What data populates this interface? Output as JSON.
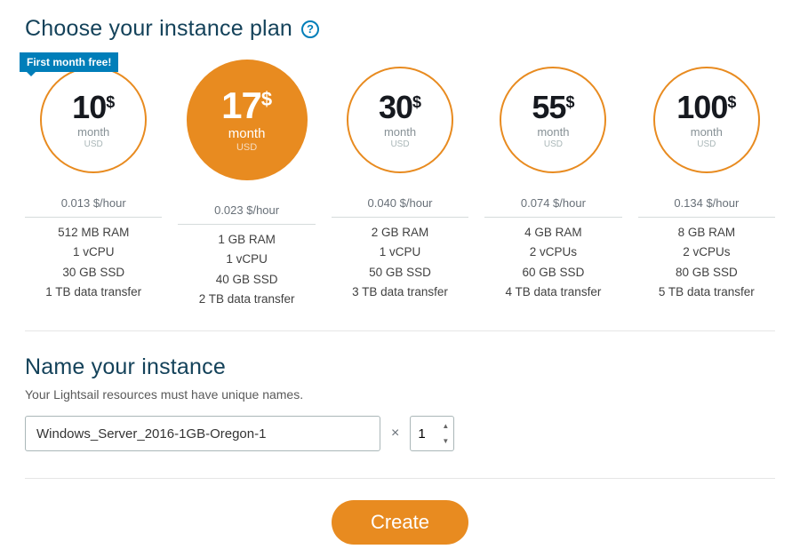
{
  "choosePlan": {
    "title": "Choose your instance plan",
    "helpLabel": "?"
  },
  "plans": [
    {
      "badge": "First month free!",
      "price": "10",
      "symbol": "$",
      "period": "month",
      "currency": "USD",
      "selected": false,
      "hourly": "0.013 $/hour",
      "ram": "512 MB RAM",
      "cpu": "1 vCPU",
      "disk": "30 GB SSD",
      "transfer": "1 TB data transfer"
    },
    {
      "price": "17",
      "symbol": "$",
      "period": "month",
      "currency": "USD",
      "selected": true,
      "hourly": "0.023 $/hour",
      "ram": "1 GB RAM",
      "cpu": "1 vCPU",
      "disk": "40 GB SSD",
      "transfer": "2 TB data transfer"
    },
    {
      "price": "30",
      "symbol": "$",
      "period": "month",
      "currency": "USD",
      "selected": false,
      "hourly": "0.040 $/hour",
      "ram": "2 GB RAM",
      "cpu": "1 vCPU",
      "disk": "50 GB SSD",
      "transfer": "3 TB data transfer"
    },
    {
      "price": "55",
      "symbol": "$",
      "period": "month",
      "currency": "USD",
      "selected": false,
      "hourly": "0.074 $/hour",
      "ram": "4 GB RAM",
      "cpu": "2 vCPUs",
      "disk": "60 GB SSD",
      "transfer": "4 TB data transfer"
    },
    {
      "price": "100",
      "symbol": "$",
      "period": "month",
      "currency": "USD",
      "selected": false,
      "hourly": "0.134 $/hour",
      "ram": "8 GB RAM",
      "cpu": "2 vCPUs",
      "disk": "80 GB SSD",
      "transfer": "5 TB data transfer"
    }
  ],
  "nameInstance": {
    "title": "Name your instance",
    "subtext": "Your Lightsail resources must have unique names.",
    "value": "Windows_Server_2016-1GB-Oregon-1",
    "times": "×",
    "quantity": "1"
  },
  "createLabel": "Create"
}
